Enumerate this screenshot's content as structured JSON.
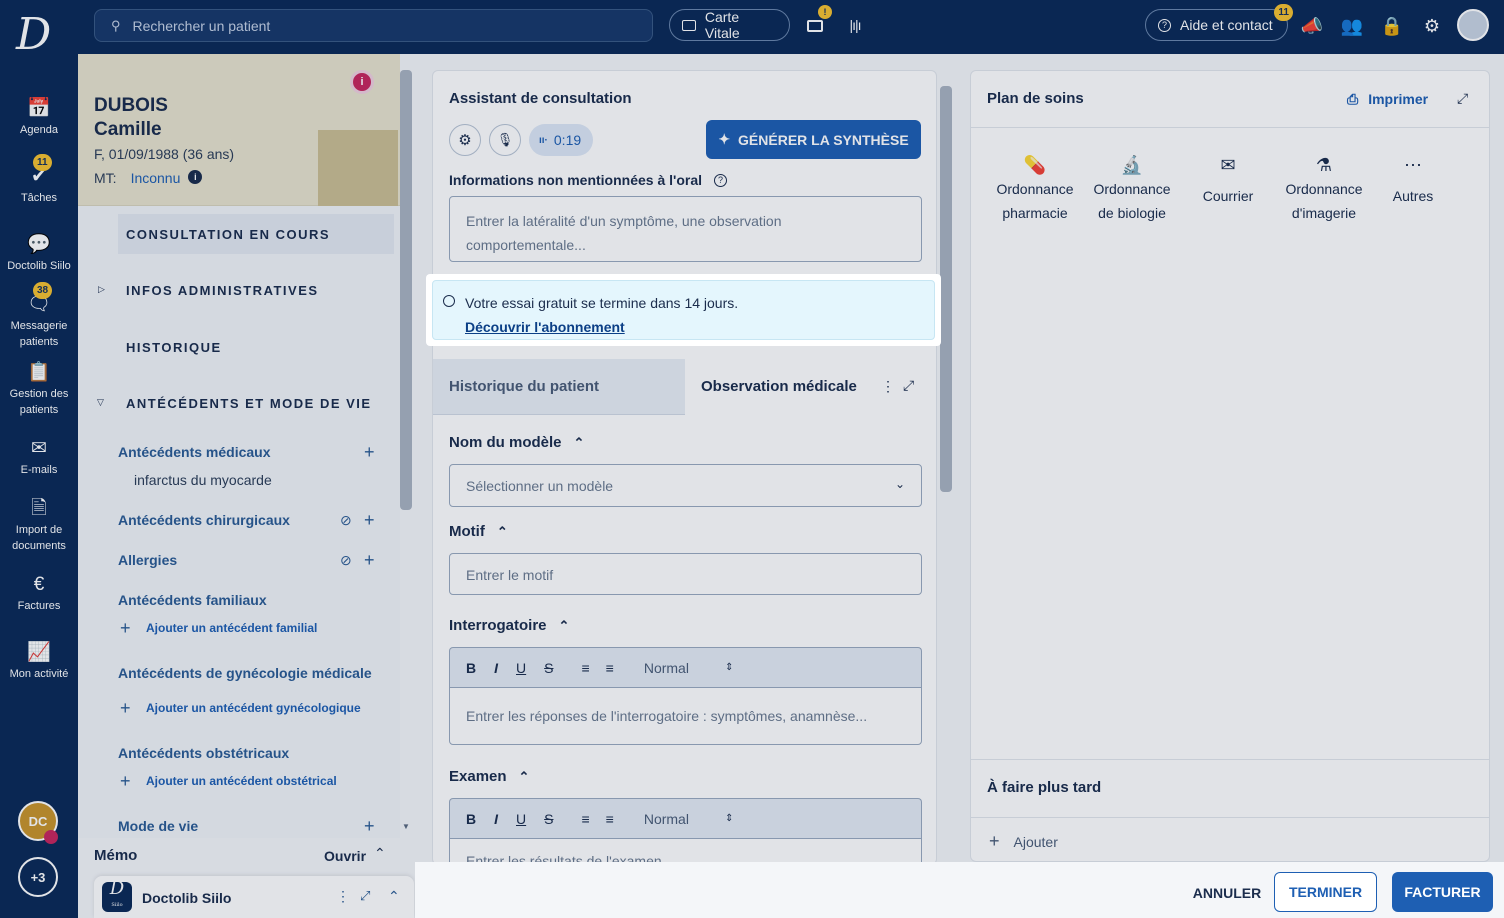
{
  "topbar": {
    "logo": "D",
    "search_placeholder": "Rechercher un patient",
    "carte_vitale": "Carte Vitale",
    "video_badge": "!",
    "aide": "Aide et contact",
    "aide_badge": "11"
  },
  "nav": {
    "agenda": "Agenda",
    "taches": "Tâches",
    "taches_badge": "11",
    "doctolib_siilo": "Doctolib Siilo",
    "messagerie": "Messagerie patients",
    "messagerie_badge": "38",
    "gestion": "Gestion des patients",
    "emails": "E-mails",
    "import": "Import de documents",
    "factures": "Factures",
    "activite": "Mon activité",
    "user_initials": "DC",
    "more": "+3"
  },
  "patient": {
    "last_name": "DUBOIS",
    "first_name": "Camille",
    "info": "F, 01/09/1988 (36 ans)",
    "mt_label": "MT:",
    "mt_value": "Inconnu",
    "sections": {
      "consultation": "CONSULTATION EN COURS",
      "infos": "INFOS ADMINISTRATIVES",
      "historique": "HISTORIQUE",
      "antecedents": "ANTÉCÉDENTS ET MODE DE VIE"
    },
    "ant_medicaux": "Antécédents médicaux",
    "ant_medicaux_item": "infarctus du myocarde",
    "ant_chirurgicaux": "Antécédents chirurgicaux",
    "allergies": "Allergies",
    "ant_familiaux": "Antécédents familiaux",
    "add_familial": "Ajouter un antécédent familial",
    "ant_gyneco": "Antécédents de gynécologie médicale",
    "add_gyneco": "Ajouter un antécédent gynécologique",
    "ant_obstetricaux": "Antécédents obstétricaux",
    "add_obstetrical": "Ajouter un antécédent obstétrical",
    "mode_de_vie": "Mode de vie",
    "memo": "Mémo",
    "memo_open": "Ouvrir",
    "siilo_bar": "Doctolib Siilo",
    "siilo_logo": "D",
    "siilo_sub": "Siilo"
  },
  "assistant": {
    "title": "Assistant de consultation",
    "timer": "0:19",
    "generate": "GÉNÉRER LA SYNTHÈSE",
    "info_label": "Informations non mentionnées à l'oral",
    "info_placeholder": "Entrer la latéralité d'un symptôme, une observation comportementale..."
  },
  "trial": {
    "message": "Votre essai gratuit se termine dans 14 jours.",
    "link": "Découvrir l'abonnement"
  },
  "tabs": {
    "historique": "Historique du patient",
    "observation": "Observation médicale"
  },
  "form": {
    "model_title": "Nom du modèle",
    "model_placeholder": "Sélectionner un modèle",
    "motif_title": "Motif",
    "motif_placeholder": "Entrer le motif",
    "interro_title": "Interrogatoire",
    "interro_placeholder": "Entrer les réponses de l'interrogatoire : symptômes, anamnèse...",
    "examen_title": "Examen",
    "examen_placeholder": "Entrer les résultats de l'examen",
    "format_normal": "Normal",
    "fmt_b": "B",
    "fmt_i": "I",
    "fmt_u": "U",
    "fmt_s": "S"
  },
  "plan": {
    "title": "Plan de soins",
    "print": "Imprimer",
    "items": [
      {
        "line1": "Ordonnance",
        "line2": "pharmacie"
      },
      {
        "line1": "Ordonnance",
        "line2": "de biologie"
      },
      {
        "line1": "Courrier",
        "line2": ""
      },
      {
        "line1": "Ordonnance",
        "line2": "d'imagerie"
      },
      {
        "line1": "Autres",
        "line2": ""
      }
    ],
    "later": "À faire plus tard",
    "add": "Ajouter"
  },
  "footer": {
    "annuler": "ANNULER",
    "terminer": "TERMINER",
    "facturer": "FACTURER"
  },
  "colors": {
    "navy": "#0b2a57",
    "primary": "#1e5fb3",
    "trial_bg": "#e4f6fd",
    "badge": "#f6c230"
  }
}
